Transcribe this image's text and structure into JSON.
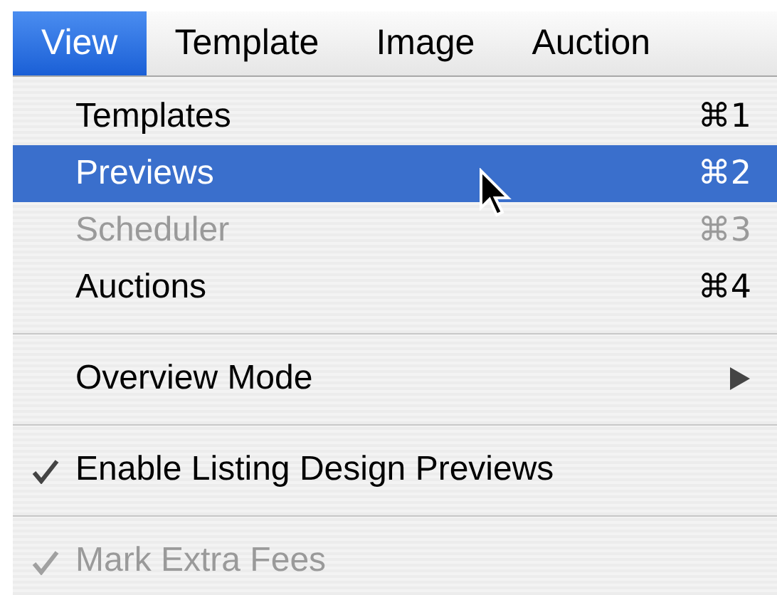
{
  "menu_bar": [
    {
      "label": "View",
      "selected": true
    },
    {
      "label": "Template",
      "selected": false
    },
    {
      "label": "Image",
      "selected": false
    },
    {
      "label": "Auction",
      "selected": false
    }
  ],
  "menu": [
    {
      "kind": "command",
      "label": "Templates",
      "shortcut": "⌘1",
      "selected": false,
      "disabled": false
    },
    {
      "kind": "command",
      "label": "Previews",
      "shortcut": "⌘2",
      "selected": true,
      "disabled": false
    },
    {
      "kind": "command",
      "label": "Scheduler",
      "shortcut": "⌘3",
      "selected": false,
      "disabled": true
    },
    {
      "kind": "command",
      "label": "Auctions",
      "shortcut": "⌘4",
      "selected": false,
      "disabled": false
    },
    {
      "kind": "separator"
    },
    {
      "kind": "submenu",
      "label": "Overview Mode",
      "selected": false,
      "disabled": false
    },
    {
      "kind": "separator"
    },
    {
      "kind": "toggle",
      "label": "Enable Listing Design Previews",
      "checked": true,
      "selected": false,
      "disabled": false
    },
    {
      "kind": "separator"
    },
    {
      "kind": "toggle",
      "label": "Mark Extra Fees",
      "checked": true,
      "selected": false,
      "disabled": true
    }
  ]
}
